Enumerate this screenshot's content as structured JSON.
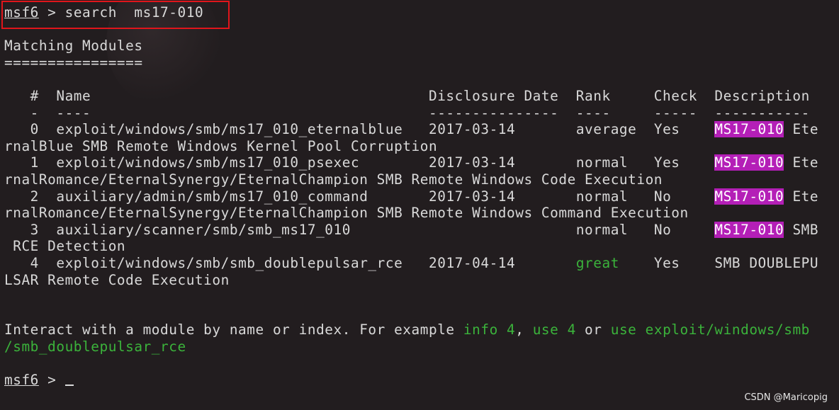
{
  "prompt": {
    "label": "msf6",
    "arrow": " > "
  },
  "command": "search  ms17-010",
  "heading": "Matching Modules",
  "heading_rule": "================",
  "columns": {
    "num": "#",
    "name": "Name",
    "date": "Disclosure Date",
    "rank": "Rank",
    "check": "Check",
    "desc": "Description"
  },
  "column_rules": {
    "num": "-",
    "name": "----",
    "date": "---------------",
    "rank": "----",
    "check": "-----",
    "desc": "-----------"
  },
  "rows": [
    {
      "num": "0",
      "name": "exploit/windows/smb/ms17_010_eternalblue",
      "date": "2017-03-14",
      "rank": "average",
      "check": "Yes",
      "tag": "MS17-010",
      "desc_tail": " Ete",
      "wrap": "rnalBlue SMB Remote Windows Kernel Pool Corruption"
    },
    {
      "num": "1",
      "name": "exploit/windows/smb/ms17_010_psexec",
      "date": "2017-03-14",
      "rank": "normal",
      "check": "Yes",
      "tag": "MS17-010",
      "desc_tail": " Ete",
      "wrap": "rnalRomance/EternalSynergy/EternalChampion SMB Remote Windows Code Execution"
    },
    {
      "num": "2",
      "name": "auxiliary/admin/smb/ms17_010_command",
      "date": "2017-03-14",
      "rank": "normal",
      "check": "No",
      "tag": "MS17-010",
      "desc_tail": " Ete",
      "wrap": "rnalRomance/EternalSynergy/EternalChampion SMB Remote Windows Command Execution"
    },
    {
      "num": "3",
      "name": "auxiliary/scanner/smb/smb_ms17_010",
      "date": "",
      "rank": "normal",
      "check": "No",
      "tag": "MS17-010",
      "desc_tail": " SMB",
      "wrap": " RCE Detection"
    },
    {
      "num": "4",
      "name": "exploit/windows/smb/smb_doublepulsar_rce",
      "date": "2017-04-14",
      "rank": "great",
      "check": "Yes",
      "tag": "",
      "desc_tail": "SMB DOUBLEPU",
      "wrap": "LSAR Remote Code Execution"
    }
  ],
  "hint": {
    "prefix": "Interact with a module by name or index. For example ",
    "example1": "info 4",
    "sep1": ", ",
    "example2": "use 4",
    "sep2": " or ",
    "example3_line1": "use exploit/windows/smb",
    "example3_line2": "/smb_doublepulsar_rce"
  },
  "watermark": "CSDN @Maricopig",
  "colors": {
    "background": "#221d1f",
    "text": "#d9d9d9",
    "green": "#3bb33b",
    "highlight": "#b41fb7",
    "annotation_box": "#e0151b"
  }
}
